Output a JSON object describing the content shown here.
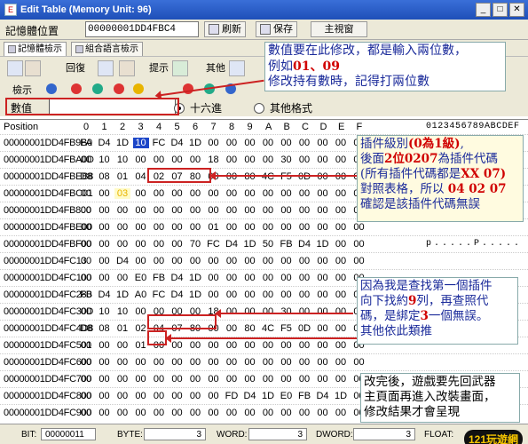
{
  "window": {
    "title": "Edit Table (Memory Unit: 96)",
    "icon": "app-icon",
    "minimize": "_",
    "maximize": "□",
    "close": "✕"
  },
  "addrbar": {
    "label": "記憶體位置",
    "address": "00000001DD4FBC4",
    "refresh": "刷新",
    "save": "保存",
    "main": "主視窗"
  },
  "tabs": [
    {
      "label": "記憶體檢示"
    },
    {
      "label": "組合語言檢示"
    }
  ],
  "toolbar": {
    "back": "回復",
    "hint": "提示",
    "other": "其他",
    "view": "檢示"
  },
  "value_row": {
    "label": "數值",
    "value": "",
    "radio_hex": "十六進",
    "radio_other": "其他格式",
    "selected": "十六進"
  },
  "grid": {
    "position_label": "Position",
    "columns": [
      "0",
      "1",
      "2",
      "3",
      "4",
      "5",
      "6",
      "7",
      "8",
      "9",
      "A",
      "B",
      "C",
      "D",
      "E",
      "F"
    ],
    "ascii_header": "0123456789ABCDEF",
    "rows": [
      {
        "addr": "00000001DD4FB9B0",
        "cells": [
          "FA",
          "D4",
          "1D",
          "10",
          "FC",
          "D4",
          "1D",
          "00",
          "00",
          "00",
          "00",
          "00",
          "00",
          "00",
          "00",
          "00"
        ],
        "ascii": ""
      },
      {
        "addr": "00000001DD4FBA0D",
        "cells": [
          "00",
          "10",
          "10",
          "00",
          "00",
          "00",
          "00",
          "18",
          "00",
          "00",
          "00",
          "30",
          "00",
          "00",
          "00",
          "00"
        ],
        "ascii": ""
      },
      {
        "addr": "00000001DD4FBEB8",
        "cells": [
          "D8",
          "08",
          "01",
          "04",
          "02",
          "07",
          "80",
          "00",
          "00",
          "80",
          "4C",
          "F5",
          "0D",
          "00",
          "00",
          "00"
        ],
        "ascii": ""
      },
      {
        "addr": "00000001DD4FBC01",
        "cells": [
          "00",
          "00",
          "03",
          "00",
          "00",
          "00",
          "00",
          "00",
          "00",
          "00",
          "00",
          "00",
          "00",
          "00",
          "00",
          "00"
        ],
        "ascii": ""
      },
      {
        "addr": "00000001DD4FB800",
        "cells": [
          "00",
          "00",
          "00",
          "00",
          "00",
          "00",
          "00",
          "00",
          "00",
          "00",
          "00",
          "00",
          "00",
          "00",
          "00",
          "00"
        ],
        "ascii": ""
      },
      {
        "addr": "00000001DD4FBE00",
        "cells": [
          "00",
          "00",
          "00",
          "00",
          "00",
          "00",
          "00",
          "01",
          "00",
          "00",
          "00",
          "00",
          "00",
          "00",
          "00",
          "00"
        ],
        "ascii": ""
      },
      {
        "addr": "00000001DD4FBF00",
        "cells": [
          "00",
          "00",
          "00",
          "00",
          "00",
          "00",
          "70",
          "FC",
          "D4",
          "1D",
          "50",
          "FB",
          "D4",
          "1D",
          "00",
          "00"
        ],
        "ascii": "p.....P....."
      },
      {
        "addr": "00000001DD4FC13",
        "cells": [
          "00",
          "00",
          "D4",
          "00",
          "00",
          "00",
          "00",
          "00",
          "00",
          "00",
          "00",
          "00",
          "00",
          "00",
          "00",
          "00"
        ],
        "ascii": ""
      },
      {
        "addr": "00000001DD4FC100",
        "cells": [
          "00",
          "00",
          "00",
          "E0",
          "FB",
          "D4",
          "1D",
          "00",
          "00",
          "00",
          "00",
          "00",
          "00",
          "00",
          "00",
          "00"
        ],
        "ascii": ""
      },
      {
        "addr": "00000001DD4FC280",
        "cells": [
          "FB",
          "D4",
          "1D",
          "A0",
          "FC",
          "D4",
          "1D",
          "00",
          "00",
          "00",
          "00",
          "00",
          "00",
          "00",
          "00",
          "00"
        ],
        "ascii": ""
      },
      {
        "addr": "00000001DD4FC30D",
        "cells": [
          "00",
          "10",
          "10",
          "00",
          "00",
          "00",
          "00",
          "18",
          "00",
          "00",
          "00",
          "30",
          "00",
          "00",
          "00",
          "00"
        ],
        "ascii": ""
      },
      {
        "addr": "00000001DD4FC4D8",
        "cells": [
          "D8",
          "08",
          "01",
          "02",
          "04",
          "07",
          "80",
          "00",
          "00",
          "80",
          "4C",
          "F5",
          "0D",
          "00",
          "00",
          "00"
        ],
        "ascii": ""
      },
      {
        "addr": "00000001DD4FC501",
        "cells": [
          "00",
          "00",
          "00",
          "01",
          "00",
          "00",
          "00",
          "00",
          "00",
          "00",
          "00",
          "00",
          "00",
          "00",
          "00",
          "00"
        ],
        "ascii": ""
      },
      {
        "addr": "00000001DD4FC600",
        "cells": [
          "00",
          "00",
          "00",
          "00",
          "00",
          "00",
          "00",
          "00",
          "00",
          "00",
          "00",
          "00",
          "00",
          "00",
          "00",
          "00"
        ],
        "ascii": ""
      },
      {
        "addr": "00000001DD4FC700",
        "cells": [
          "00",
          "00",
          "00",
          "00",
          "00",
          "00",
          "00",
          "00",
          "00",
          "00",
          "00",
          "00",
          "00",
          "00",
          "00",
          "00"
        ],
        "ascii": ""
      },
      {
        "addr": "00000001DD4FC800",
        "cells": [
          "00",
          "00",
          "00",
          "00",
          "00",
          "00",
          "00",
          "00",
          "FD",
          "D4",
          "1D",
          "E0",
          "FB",
          "D4",
          "1D",
          "00"
        ],
        "ascii": ""
      },
      {
        "addr": "00000001DD4FC900",
        "cells": [
          "00",
          "00",
          "00",
          "00",
          "00",
          "00",
          "00",
          "00",
          "00",
          "00",
          "00",
          "00",
          "00",
          "00",
          "00",
          "00"
        ],
        "ascii": ""
      }
    ]
  },
  "notes": {
    "note1": {
      "line1": "數值要在此修改，都是輸入兩位數，",
      "line2_pre": "例如",
      "line2_hl": "01、09",
      "line3": "修改持有數時，記得打兩位數"
    },
    "note2": {
      "l1_pre": "插件級別",
      "l1_hl": "(0為1級)",
      "l1_post": ",",
      "l2_pre": "後面",
      "l2_hl": "2位0207",
      "l2_post": "為插件代碼",
      "l3_pre": "(所有插件代碼都是",
      "l3_hl": "XX 07)",
      "l4_pre": "對照表格，所以 ",
      "l4_hl": "04 02 07",
      "l5": "確認是該插件代碼無誤"
    },
    "note3": {
      "l1": "因為我是查找第一個插件",
      "l2_pre": "向下找約",
      "l2_hl": "9",
      "l2_post": "列，再查照代",
      "l3_pre": "碼，是綁定",
      "l3_hl": "3",
      "l3_post": "一個無誤。",
      "l4": "其他依此類推"
    },
    "note4": {
      "l1": "改完後，遊戲要先回武器",
      "l2": "主頁面再進入改裝畫面，",
      "l3": "修改結果才會呈現"
    }
  },
  "status": {
    "bit_label": "BIT:",
    "bit_value": "00000011",
    "byte_label": "BYTE:",
    "byte_value": "3",
    "word_label": "WORD:",
    "word_value": "3",
    "dword_label": "DWORD:",
    "dword_value": "3",
    "float_label": "FLOAT:",
    "watermark": "121玩遊網"
  },
  "colors": {
    "title_blue": "#1e4fb8",
    "annotation_red": "#c22",
    "note_blue": "#1a2a9a",
    "highlight_red": "#d00000",
    "selection": "#1c46c8"
  }
}
